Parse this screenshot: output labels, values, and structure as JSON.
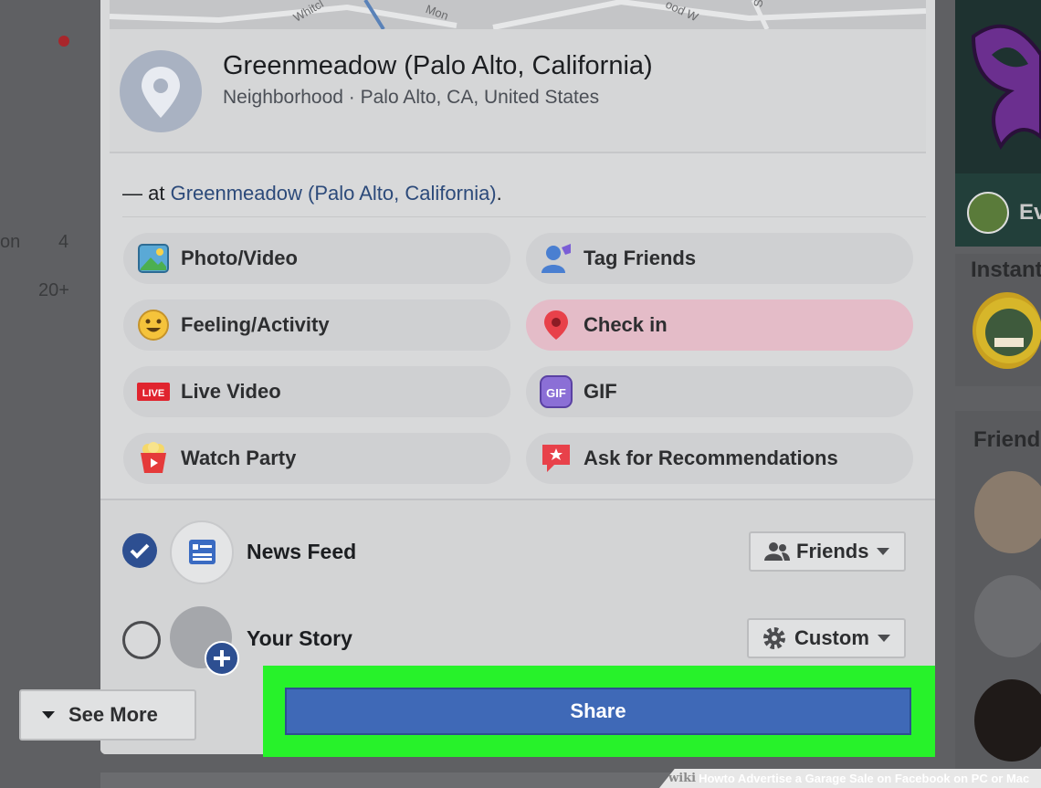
{
  "dialog": {
    "map": {
      "streets": [
        "Whitcl",
        "Mon",
        "ood W",
        "S"
      ]
    },
    "location": {
      "name": "Greenmeadow (Palo Alto, California)",
      "subtitle": "Neighborhood · Palo Alto, CA, United States"
    },
    "at_line": {
      "prefix": "— at ",
      "link": "Greenmeadow (Palo Alto, California)",
      "suffix": "."
    },
    "options": [
      {
        "label": "Photo/Video",
        "icon": "photo-video-icon"
      },
      {
        "label": "Tag Friends",
        "icon": "tag-friends-icon"
      },
      {
        "label": "Feeling/Activity",
        "icon": "feeling-icon"
      },
      {
        "label": "Check in",
        "icon": "check-in-icon",
        "active": true
      },
      {
        "label": "Live Video",
        "icon": "live-video-icon",
        "badge": "LIVE"
      },
      {
        "label": "GIF",
        "icon": "gif-icon",
        "badge": "GIF"
      },
      {
        "label": "Watch Party",
        "icon": "watch-party-icon"
      },
      {
        "label": "Ask for Recommendations",
        "icon": "recommendations-icon"
      }
    ],
    "destinations": [
      {
        "label": "News Feed",
        "checked": true,
        "audience": "Friends",
        "audience_icon": "friends-icon"
      },
      {
        "label": "Your Story",
        "checked": false,
        "audience": "Custom",
        "audience_icon": "gear-icon"
      }
    ],
    "see_more": "See More",
    "share": "Share"
  },
  "left": {
    "fragment": "on",
    "count1": "4",
    "count2": "20+"
  },
  "right": {
    "title1": "Instant",
    "title2": "Friend",
    "game_text": "Ev"
  },
  "watermark": {
    "wiki": "wiki",
    "how": "How",
    "rest": " to Advertise a Garage Sale on Facebook on PC or Mac"
  },
  "colors": {
    "highlight": "#27f22a",
    "share": "#3f69b7",
    "link": "#2c4a7a",
    "check": "#2d4f91"
  }
}
